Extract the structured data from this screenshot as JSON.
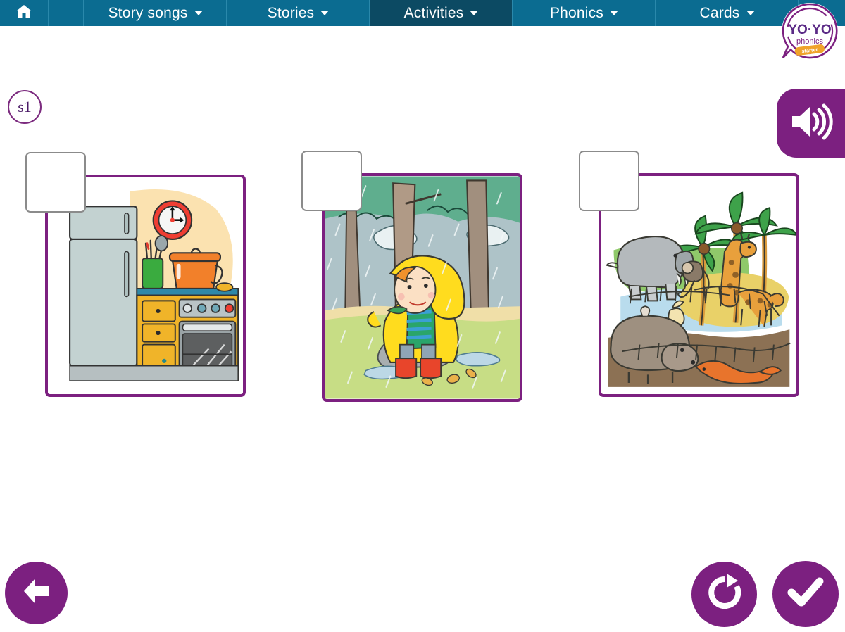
{
  "app": {
    "title": "YO-YO phonics",
    "logo_text_primary": "YO·YO",
    "logo_text_secondary": "phonics",
    "logo_banner_text": "starter"
  },
  "navbar": {
    "items": [
      {
        "id": "home",
        "label": "",
        "icon": "home-icon",
        "has_caret": false,
        "active": false
      },
      {
        "id": "spacer",
        "label": "",
        "icon": "",
        "has_caret": false,
        "active": false
      },
      {
        "id": "story-songs",
        "label": "Story songs",
        "icon": "chevron-down-icon",
        "has_caret": true,
        "active": false
      },
      {
        "id": "stories",
        "label": "Stories",
        "icon": "chevron-down-icon",
        "has_caret": true,
        "active": false
      },
      {
        "id": "activities",
        "label": "Activities",
        "icon": "chevron-down-icon",
        "has_caret": true,
        "active": true
      },
      {
        "id": "phonics",
        "label": "Phonics",
        "icon": "chevron-down-icon",
        "has_caret": true,
        "active": false
      },
      {
        "id": "cards",
        "label": "Cards",
        "icon": "chevron-down-icon",
        "has_caret": true,
        "active": false
      }
    ]
  },
  "activity": {
    "badge_label": "s1",
    "audio_button_label": "speaker-icon",
    "cards": [
      {
        "id": "card-1",
        "scene": "kitchen",
        "drop_box_value": "",
        "drop_box_placeholder": ""
      },
      {
        "id": "card-2",
        "scene": "rain-forest-child",
        "drop_box_value": "",
        "drop_box_placeholder": ""
      },
      {
        "id": "card-3",
        "scene": "zoo",
        "drop_box_value": "",
        "drop_box_placeholder": ""
      }
    ]
  },
  "controls": {
    "back_label": "back-arrow-icon",
    "reset_label": "refresh-icon",
    "confirm_label": "check-icon"
  },
  "colors": {
    "nav_background": "#0b6c91",
    "nav_active": "#0c4a63",
    "nav_divider": "#2a88ab",
    "accent_purple": "#7c2080",
    "badge_border": "#7c2b7f",
    "page_background": "#ffffff",
    "drop_box_border": "#8b8b8b"
  }
}
